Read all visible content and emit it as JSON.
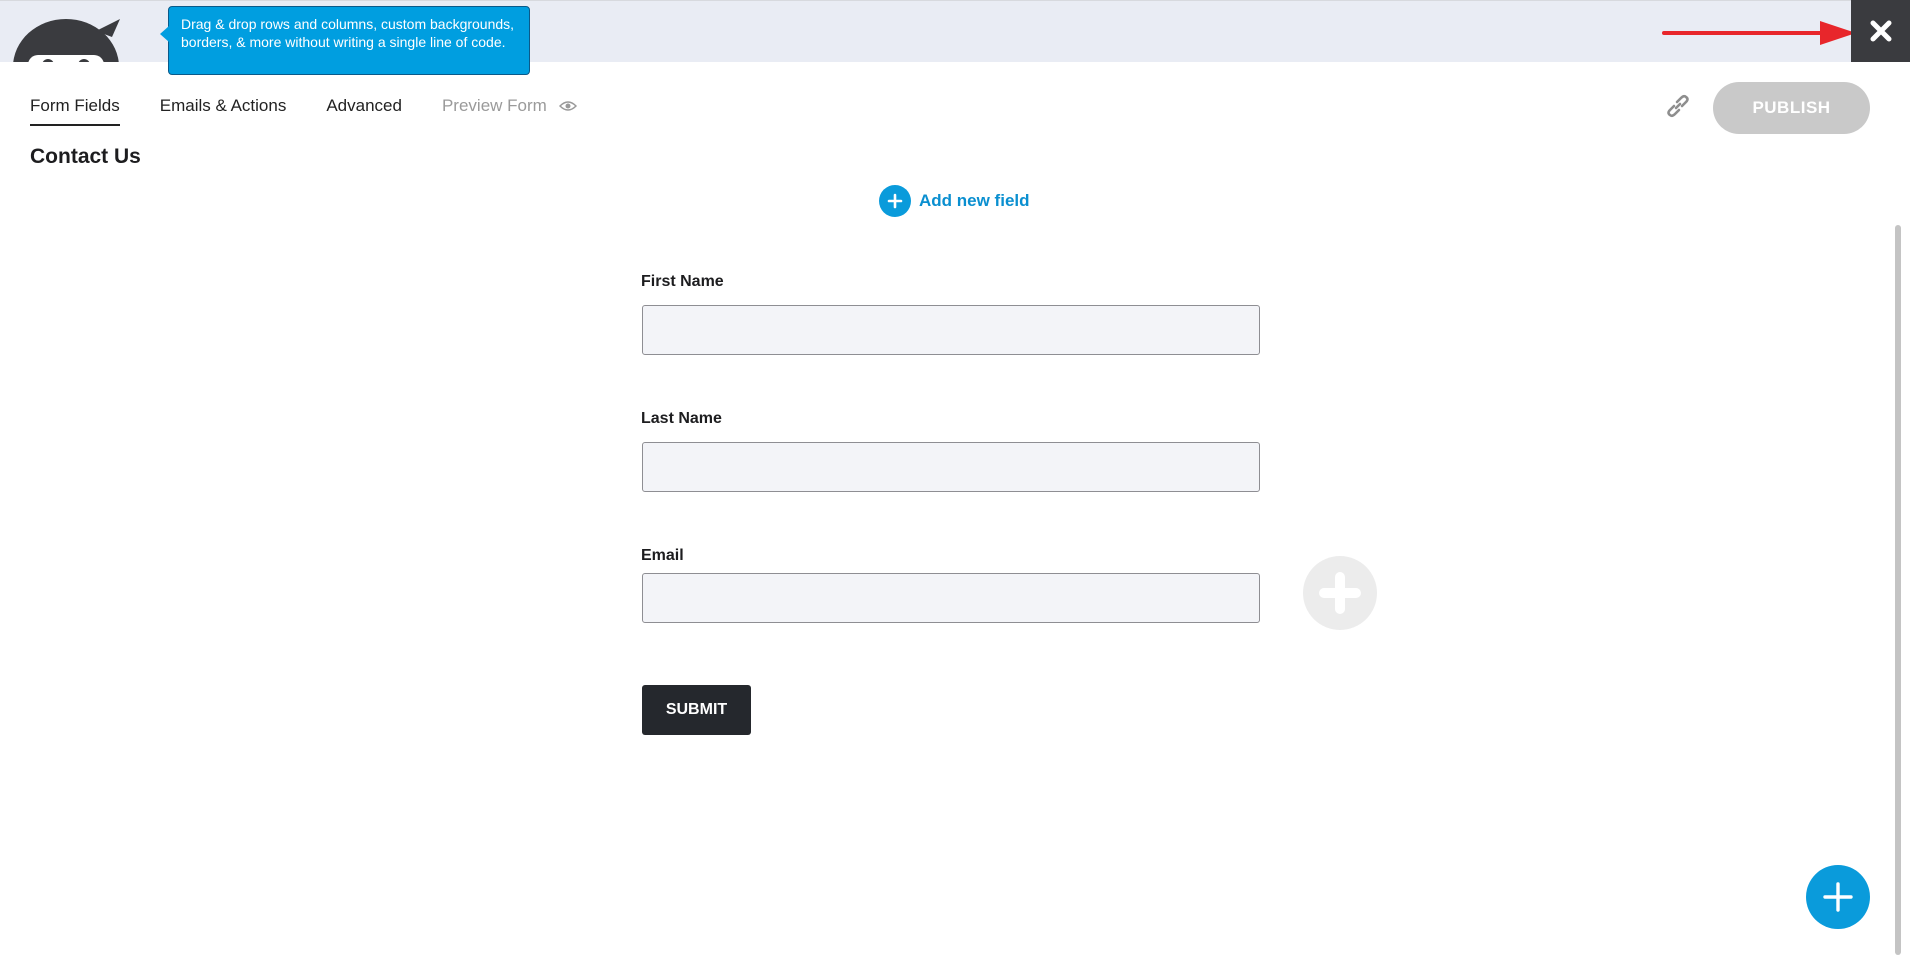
{
  "banner": {
    "tooltip_text": "Drag & drop rows and columns, custom backgrounds, borders, & more without writing a single line of code.",
    "logo_icon": "ninja-logo-icon",
    "close_icon": "close-icon",
    "arrow_color": "#e8262b"
  },
  "tabs": [
    {
      "label": "Form Fields",
      "active": true
    },
    {
      "label": "Emails & Actions",
      "active": false
    },
    {
      "label": "Advanced",
      "active": false
    },
    {
      "label": "Preview Form",
      "active": false,
      "icon": "eye-icon"
    }
  ],
  "toolbar": {
    "link_icon": "link-icon",
    "publish_label": "PUBLISH"
  },
  "form": {
    "title": "Contact Us",
    "add_field_label": "Add new field",
    "fields": [
      {
        "label": "First Name",
        "value": ""
      },
      {
        "label": "Last Name",
        "value": ""
      },
      {
        "label": "Email",
        "value": ""
      }
    ],
    "submit_label": "SUBMIT"
  },
  "colors": {
    "accent": "#0a9bdb",
    "banner_bg": "#e9ecf4",
    "close_bg": "#3a3b3f",
    "publish_disabled": "#c9c9c9",
    "submit_bg": "#25282d"
  }
}
